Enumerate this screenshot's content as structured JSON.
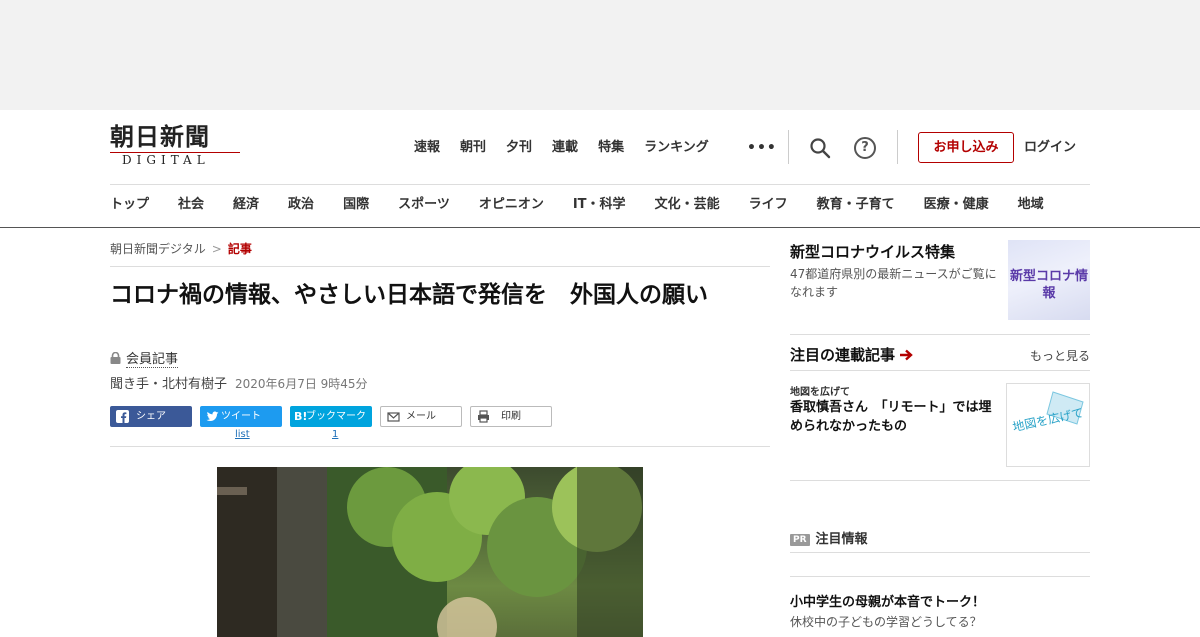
{
  "header": {
    "logo_kanji": "朝日新聞",
    "logo_sub": "DIGITAL",
    "top_nav": [
      "速報",
      "朝刊",
      "夕刊",
      "連載",
      "特集",
      "ランキング"
    ],
    "more_dots": "•••",
    "help_glyph": "?",
    "apply_label": "お申し込み",
    "login_label": "ログイン",
    "category_nav": [
      "トップ",
      "社会",
      "経済",
      "政治",
      "国際",
      "スポーツ",
      "オピニオン",
      "IT・科学",
      "文化・芸能",
      "ライフ",
      "教育・子育て",
      "医療・健康",
      "地域"
    ]
  },
  "breadcrumb": {
    "root": "朝日新聞デジタル",
    "separator": ">",
    "current": "記事"
  },
  "article": {
    "title": "コロナ禍の情報、やさしい日本語で発信を　外国人の願い",
    "member_label": "会員記事",
    "byline": "聞き手・北村有樹子",
    "date": "2020年6月7日 9時45分"
  },
  "share": {
    "facebook": "シェア",
    "twitter": "ツイート",
    "hatena": "ブックマーク",
    "mail": "メール",
    "print": "印刷",
    "twitter_count": "list",
    "hatena_count": "1"
  },
  "sidebar": {
    "promo": {
      "title": "新型コロナウイルス特集",
      "text": "47都道府県別の最新ニュースがご覧になれます",
      "image_text": "新型コロナ情報"
    },
    "serial": {
      "heading": "注目の連載記事",
      "more": "もっと見る",
      "item_label": "地図を広げて",
      "item_title": "香取慎吾さん　「リモート」では埋められなかったもの",
      "image_text": "地図を広げて"
    },
    "pr": {
      "badge": "PR",
      "heading": "注目情報",
      "title": "小中学生の母親が本音でトーク！",
      "sub": "休校中の子どもの学習どうしてる？"
    }
  },
  "colors": {
    "accent": "#b30000",
    "facebook": "#3b5998",
    "twitter": "#1d9bf0",
    "hatena": "#00a4de"
  }
}
